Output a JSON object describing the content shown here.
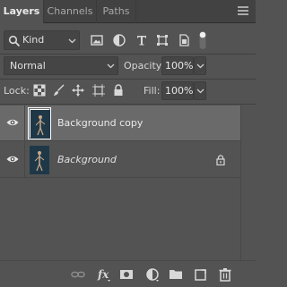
{
  "tabs": [
    {
      "label": "Layers",
      "active": true
    },
    {
      "label": "Channels",
      "active": false
    },
    {
      "label": "Paths",
      "active": false
    }
  ],
  "filter": {
    "kind_label": "Kind",
    "icons": [
      "image-filter-icon",
      "adjustment-filter-icon",
      "type-filter-icon",
      "shape-filter-icon",
      "smart-object-filter-icon",
      "filter-toggle-icon"
    ]
  },
  "blend": {
    "mode": "Normal",
    "opacity_label": "Opacity:",
    "opacity_value": "100%"
  },
  "lock": {
    "label": "Lock:",
    "fill_label": "Fill:",
    "fill_value": "100%"
  },
  "layers": [
    {
      "name": "Background copy",
      "selected": true,
      "visible": true,
      "locked": false,
      "italic": false
    },
    {
      "name": "Background",
      "selected": false,
      "visible": true,
      "locked": true,
      "italic": true
    }
  ],
  "bottom_icons": [
    "link-layers-icon",
    "fx-icon",
    "layer-mask-icon",
    "adjustment-layer-icon",
    "group-folder-icon",
    "new-layer-icon",
    "trash-icon"
  ],
  "colors": {
    "panel_bg": "#535353",
    "tab_bar_bg": "#424242",
    "selected_row": "#6a6a6a",
    "thumbnail_bg": "#1f3848"
  }
}
